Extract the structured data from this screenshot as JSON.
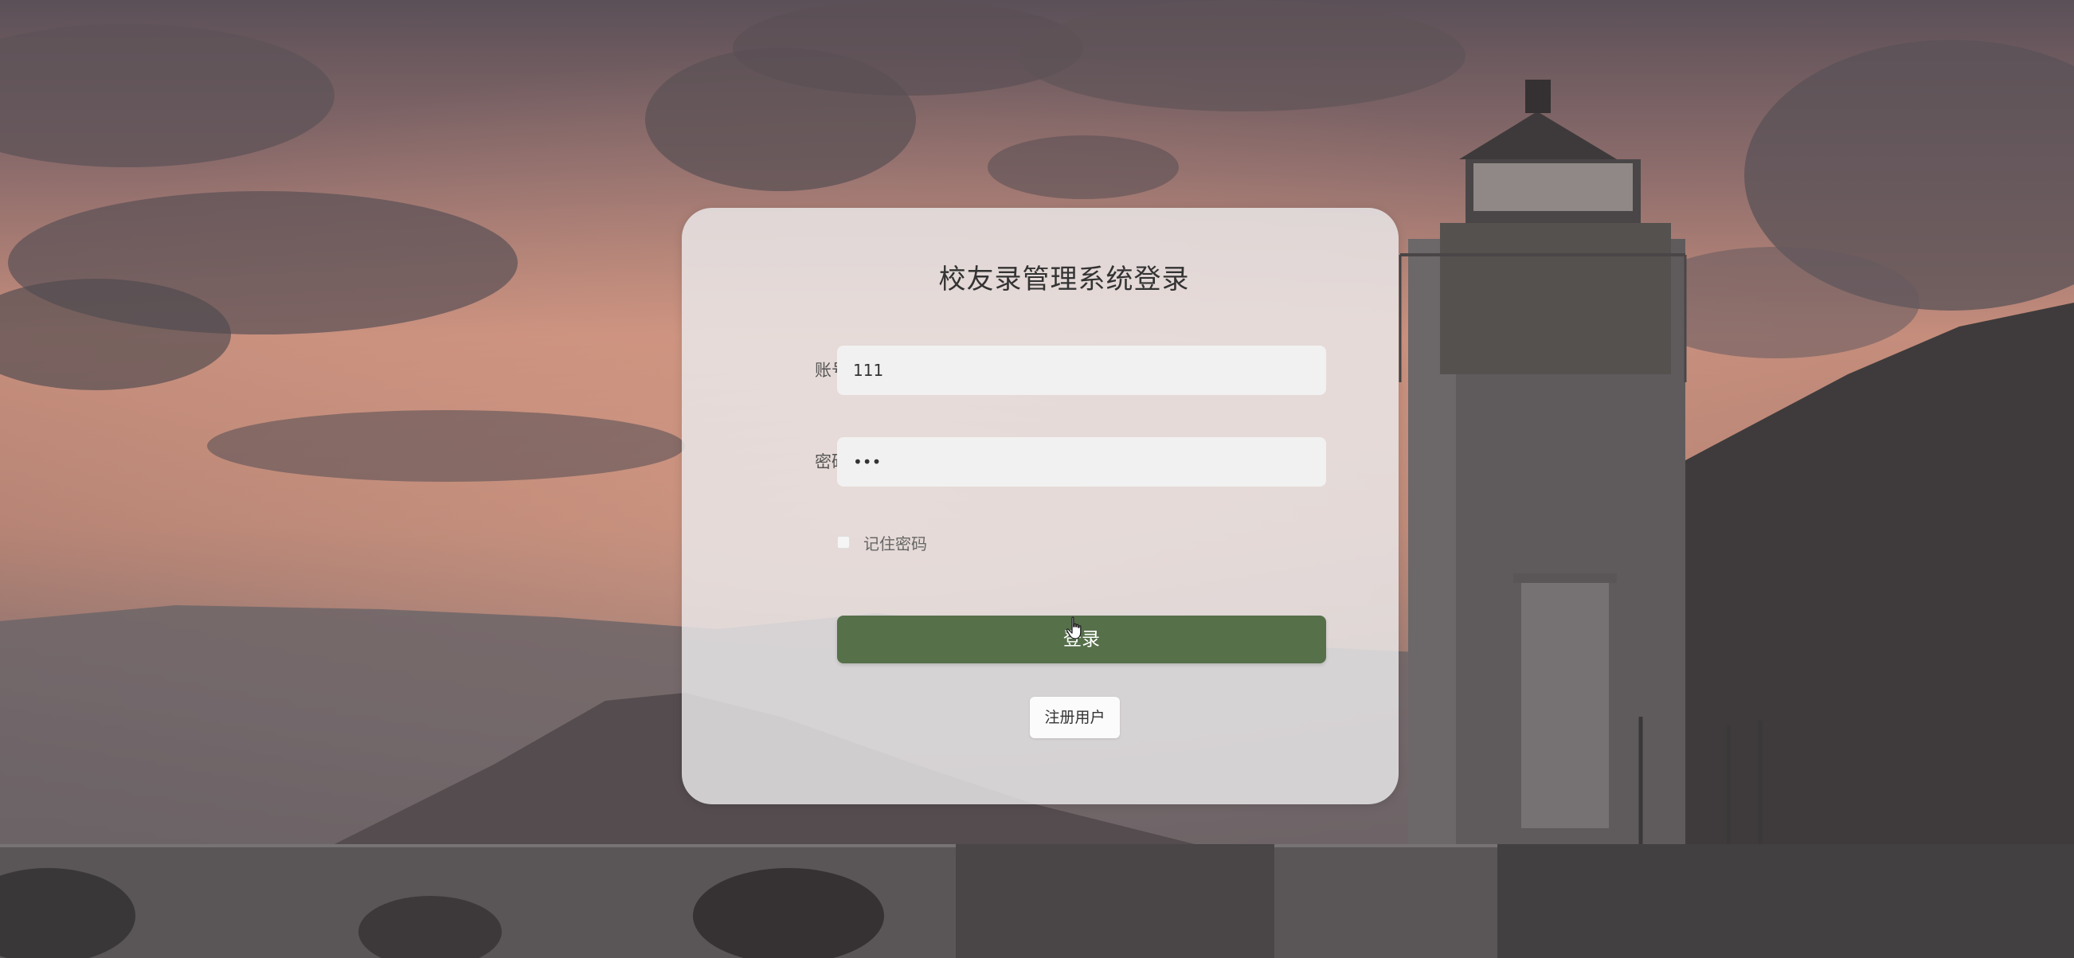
{
  "login_form": {
    "title": "校友录管理系统登录",
    "username_label": "账号：",
    "username_value": "111",
    "password_label": "密码：",
    "password_value": "•••",
    "remember_label": "记住密码",
    "remember_checked": false,
    "login_button_label": "登录",
    "register_button_label": "注册用户"
  },
  "colors": {
    "login_button": "#56704a",
    "card_background": "#eceaec"
  },
  "icons": {
    "cursor": "hand-pointer-icon"
  }
}
